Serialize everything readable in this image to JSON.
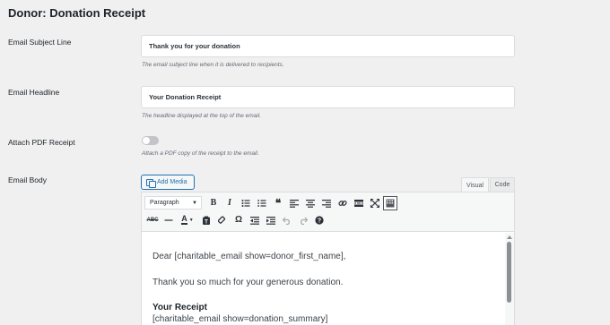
{
  "page": {
    "title": "Donor: Donation Receipt"
  },
  "fields": {
    "subject": {
      "label": "Email Subject Line",
      "value": "Thank you for your donation",
      "description": "The email subject line when it is delivered to recipients."
    },
    "headline": {
      "label": "Email Headline",
      "value": "Your Donation Receipt",
      "description": "The headline displayed at the top of the email."
    },
    "pdf": {
      "label": "Attach PDF Receipt",
      "enabled": false,
      "description": "Attach a PDF copy of the receipt to the email."
    },
    "body": {
      "label": "Email Body"
    }
  },
  "editor": {
    "add_media_label": "Add Media",
    "tabs": {
      "visual": "Visual",
      "code": "Code"
    },
    "format_select": "Paragraph",
    "content": {
      "line1": "Dear [charitable_email show=donor_first_name],",
      "line2": "Thank you so much for your generous donation.",
      "heading": "Your Receipt",
      "line3": "[charitable_email show=donation_summary]"
    }
  },
  "colors": {
    "accent": "#2271b1",
    "background": "#f0f0f1",
    "toggle_off": "#c3c4c7"
  }
}
